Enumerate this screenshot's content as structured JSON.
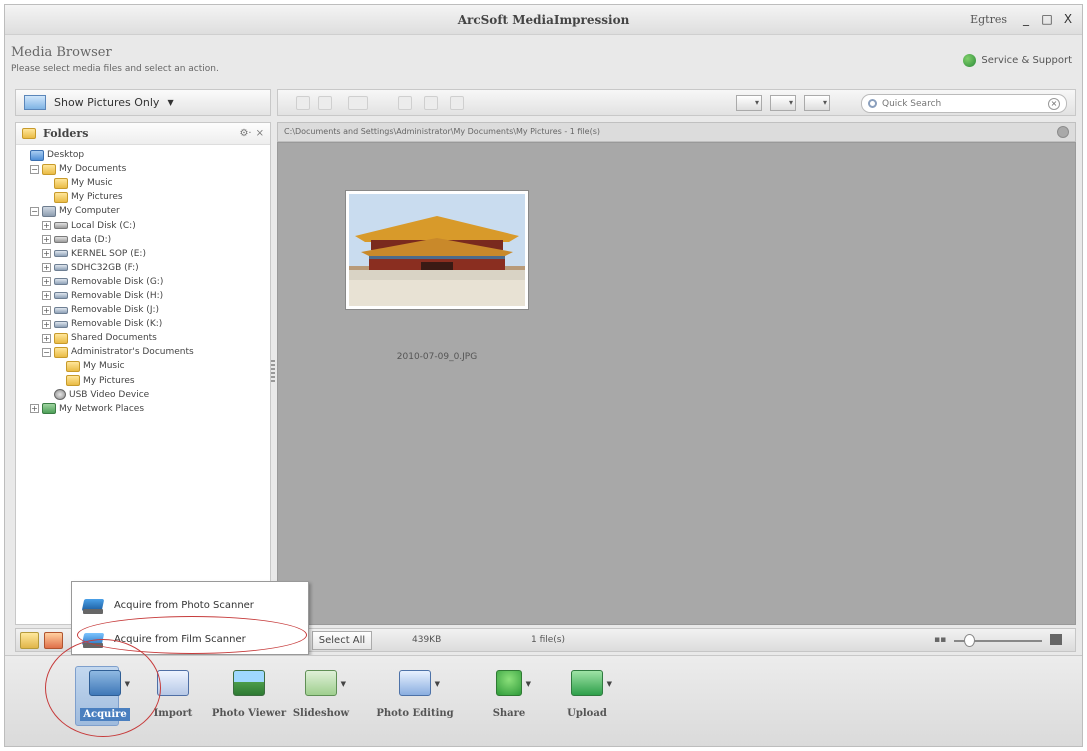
{
  "window": {
    "title": "ArcSoft MediaImpression",
    "language": "Egtres",
    "minimize": "_",
    "maximize": "□",
    "close": "X"
  },
  "header": {
    "title": "Media Browser",
    "subtitle": "Please select media files and select an action.",
    "support": "Service & Support"
  },
  "left": {
    "filter": "Show Pictures Only",
    "filter_caret": "▼",
    "folders_title": "Folders",
    "folders_options": "⚙·",
    "folders_close": "×",
    "tree": [
      {
        "label": "Desktop",
        "icon": "desktop",
        "indent": 0,
        "expander": ""
      },
      {
        "label": "My Documents",
        "icon": "folder",
        "indent": 1,
        "expander": "−"
      },
      {
        "label": "My Music",
        "icon": "folder",
        "indent": 2,
        "expander": ""
      },
      {
        "label": "My Pictures",
        "icon": "folder",
        "indent": 2,
        "expander": ""
      },
      {
        "label": "My Computer",
        "icon": "computer",
        "indent": 1,
        "expander": "−"
      },
      {
        "label": "Local Disk (C:)",
        "icon": "drive",
        "indent": 2,
        "expander": "+"
      },
      {
        "label": "data (D:)",
        "icon": "drive",
        "indent": 2,
        "expander": "+"
      },
      {
        "label": "KERNEL SOP (E:)",
        "icon": "removable",
        "indent": 2,
        "expander": "+"
      },
      {
        "label": "SDHC32GB (F:)",
        "icon": "removable",
        "indent": 2,
        "expander": "+"
      },
      {
        "label": "Removable Disk (G:)",
        "icon": "removable",
        "indent": 2,
        "expander": "+"
      },
      {
        "label": "Removable Disk (H:)",
        "icon": "removable",
        "indent": 2,
        "expander": "+"
      },
      {
        "label": "Removable Disk (J:)",
        "icon": "removable",
        "indent": 2,
        "expander": "+"
      },
      {
        "label": "Removable Disk (K:)",
        "icon": "removable",
        "indent": 2,
        "expander": "+"
      },
      {
        "label": "Shared Documents",
        "icon": "folder",
        "indent": 2,
        "expander": "+"
      },
      {
        "label": "Administrator's Documents",
        "icon": "folder",
        "indent": 2,
        "expander": "−"
      },
      {
        "label": "My Music",
        "icon": "folder",
        "indent": 3,
        "expander": ""
      },
      {
        "label": "My Pictures",
        "icon": "folder",
        "indent": 3,
        "expander": ""
      },
      {
        "label": "USB Video Device",
        "icon": "cam",
        "indent": 2,
        "expander": ""
      },
      {
        "label": "My Network Places",
        "icon": "net",
        "indent": 1,
        "expander": "+"
      }
    ]
  },
  "main": {
    "search_placeholder": "Quick Search",
    "path": "C:\\Documents and Settings\\Administrator\\My Documents\\My Pictures - 1 file(s)",
    "thumbnail_label": "2010-07-09_0.JPG"
  },
  "status": {
    "select_all": "Select All",
    "size": "439KB",
    "count": "1 file(s)"
  },
  "acquire_menu": {
    "items": [
      "Acquire from Photo Scanner",
      "Acquire from Film Scanner"
    ]
  },
  "actions": [
    {
      "label": "Acquire",
      "icon": "acquire",
      "dropdown": true
    },
    {
      "label": "Import",
      "icon": "import",
      "dropdown": false
    },
    {
      "label": "Photo Viewer",
      "icon": "viewer",
      "dropdown": false
    },
    {
      "label": "Slideshow",
      "icon": "slide",
      "dropdown": true
    },
    {
      "label": "Photo Editing",
      "icon": "edit",
      "dropdown": true
    },
    {
      "label": "Share",
      "icon": "share",
      "dropdown": true
    },
    {
      "label": "Upload",
      "icon": "upload",
      "dropdown": true
    }
  ]
}
